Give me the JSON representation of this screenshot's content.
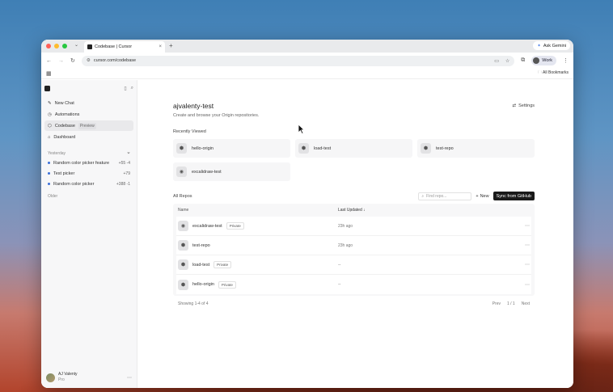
{
  "browser": {
    "tab_title": "Codebase | Cursor",
    "url": "cursor.com/codebase",
    "ask_gemini": "Ask Gemini",
    "profile": "Work",
    "all_bookmarks": "All Bookmarks"
  },
  "sidebar": {
    "nav": [
      {
        "label": "New Chat"
      },
      {
        "label": "Automations"
      },
      {
        "label": "Codebase",
        "badge": "Preview"
      },
      {
        "label": "Dashboard"
      }
    ],
    "section_yesterday": "Yesterday",
    "chats": [
      {
        "label": "Random color picker feature",
        "diff": "+55 -4"
      },
      {
        "label": "Test picker",
        "diff": "+79"
      },
      {
        "label": "Random color picker",
        "diff": "+388 -1"
      }
    ],
    "section_older": "Older",
    "user": {
      "name": "AJ Valenty",
      "plan": "Pro"
    }
  },
  "main": {
    "title": "ajvalenty-test",
    "subtitle": "Create and browse your Origin repositories.",
    "settings": "Settings",
    "recently_viewed_label": "Recently Viewed",
    "recent": [
      {
        "name": "hello-origin"
      },
      {
        "name": "load-test"
      },
      {
        "name": "test-repo"
      },
      {
        "name": "excalidraw-test"
      }
    ],
    "all_repos_label": "All Repos",
    "find_placeholder": "Find repo...",
    "new_label": "New",
    "sync_label": "Sync from GitHub",
    "columns": {
      "name": "Name",
      "updated": "Last Updated ↓"
    },
    "repos": [
      {
        "name": "excalidraw-test",
        "badge": "Private",
        "updated": "23h ago"
      },
      {
        "name": "test-repo",
        "badge": "",
        "updated": "23h ago"
      },
      {
        "name": "load-test",
        "badge": "Private",
        "updated": "--"
      },
      {
        "name": "hello-origin",
        "badge": "Private",
        "updated": "--"
      }
    ],
    "showing": "Showing 1-4 of 4",
    "prev": "Prev",
    "page": "1 / 1",
    "next": "Next"
  }
}
